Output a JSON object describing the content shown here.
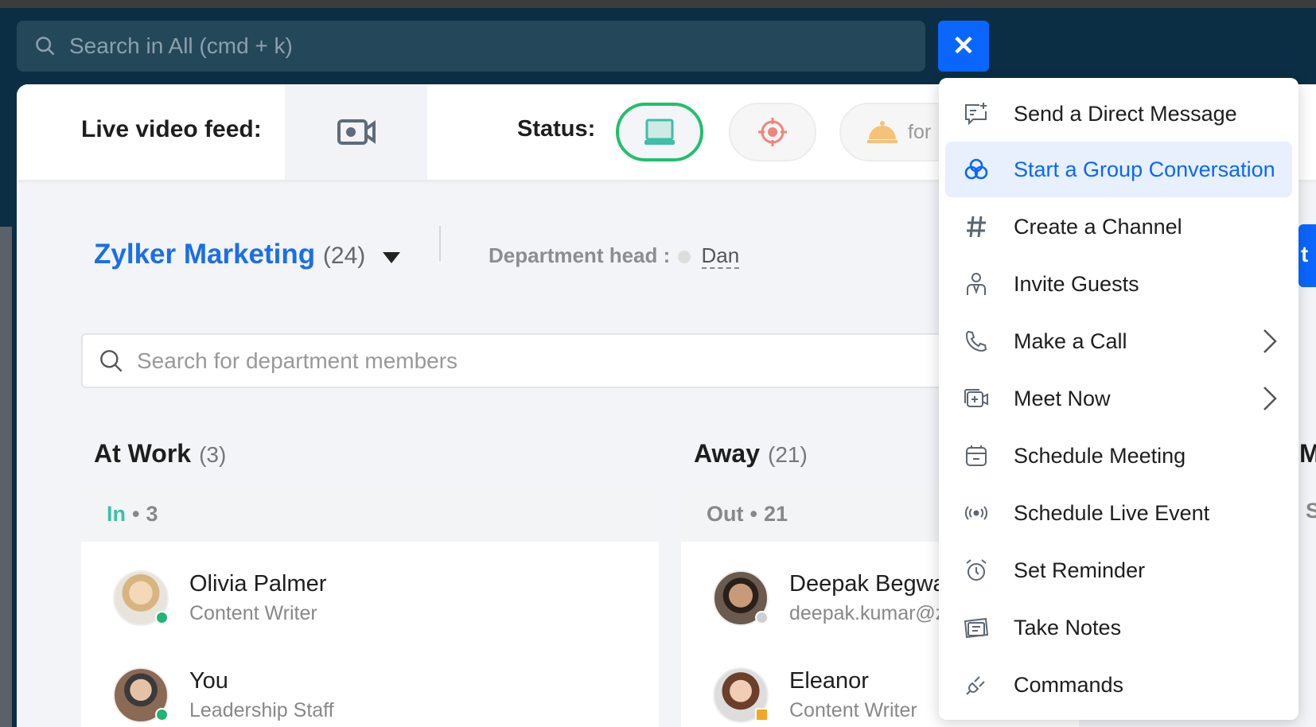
{
  "topbar": {
    "search_placeholder": "Search in All (cmd + k)",
    "close_label": "✕"
  },
  "header": {
    "live_video_label": "Live video feed:",
    "status_label": "Status:",
    "status_pill_partial": "for"
  },
  "department": {
    "name": "Zylker Marketing",
    "count": "(24)",
    "head_label": "Department head :",
    "head_name": "Dan",
    "search_placeholder": "Search for department members"
  },
  "sections": [
    {
      "title": "At Work",
      "count": "(3)",
      "sub_label": "In",
      "sub_count": "3",
      "members": [
        {
          "name": "Olivia Palmer",
          "role": "Content Writer",
          "status_color": "#22b573"
        },
        {
          "name": "You",
          "role": "Leadership Staff",
          "status_color": "#22b573"
        }
      ]
    },
    {
      "title": "Away",
      "count": "(21)",
      "sub_label": "Out",
      "sub_count": "21",
      "members": [
        {
          "name": "Deepak Begwa",
          "role": "deepak.kumar@z",
          "status_color": "#cfcfcf"
        },
        {
          "name": "Eleanor",
          "role": "Content Writer",
          "status_color": "#f5a623"
        }
      ]
    }
  ],
  "right_partial": {
    "button_text": "t",
    "section_letter": "M",
    "sub_letter": "S"
  },
  "menu": {
    "items": [
      {
        "label": "Send a Direct Message",
        "icon": "message-plus-icon"
      },
      {
        "label": "Start a Group Conversation",
        "icon": "group-icon",
        "active": true
      },
      {
        "label": "Create a Channel",
        "icon": "hash-icon"
      },
      {
        "label": "Invite Guests",
        "icon": "guest-icon"
      },
      {
        "label": "Make a Call",
        "icon": "phone-icon",
        "submenu": true
      },
      {
        "label": "Meet Now",
        "icon": "video-plus-icon",
        "submenu": true
      },
      {
        "label": "Schedule Meeting",
        "icon": "calendar-icon"
      },
      {
        "label": "Schedule Live Event",
        "icon": "broadcast-icon"
      },
      {
        "label": "Set Reminder",
        "icon": "alarm-icon"
      },
      {
        "label": "Take Notes",
        "icon": "notes-icon"
      },
      {
        "label": "Commands",
        "icon": "plug-icon"
      }
    ]
  },
  "colors": {
    "accent": "#0a66ff",
    "navy": "#0b2e44",
    "online": "#22b573"
  }
}
